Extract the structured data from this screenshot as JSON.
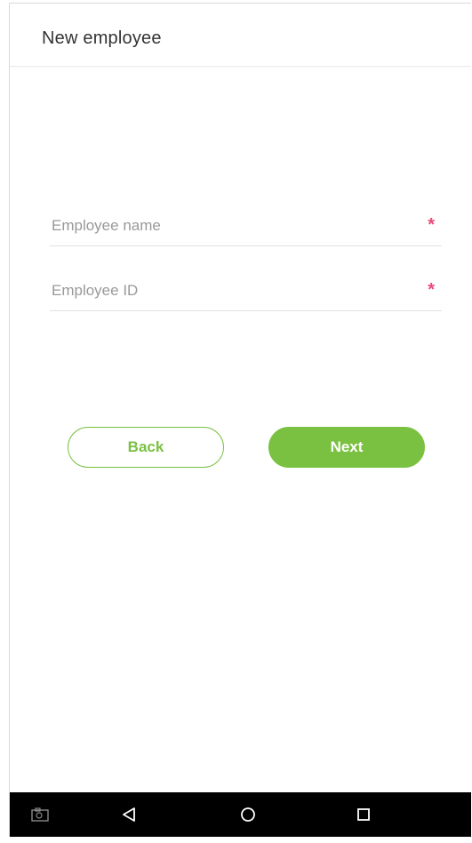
{
  "header": {
    "title": "New employee"
  },
  "form": {
    "employee_name": {
      "value": "",
      "placeholder": "Employee name",
      "required_mark": "*"
    },
    "employee_id": {
      "value": "",
      "placeholder": "Employee ID",
      "required_mark": "*"
    }
  },
  "buttons": {
    "back_label": "Back",
    "next_label": "Next"
  },
  "colors": {
    "accent": "#7ac142",
    "required": "#e94a78",
    "navbar": "#000000"
  },
  "navbar": {
    "items": [
      {
        "icon": "screenshot-icon"
      },
      {
        "icon": "back-triangle-icon"
      },
      {
        "icon": "home-circle-icon"
      },
      {
        "icon": "recents-square-icon"
      }
    ]
  }
}
